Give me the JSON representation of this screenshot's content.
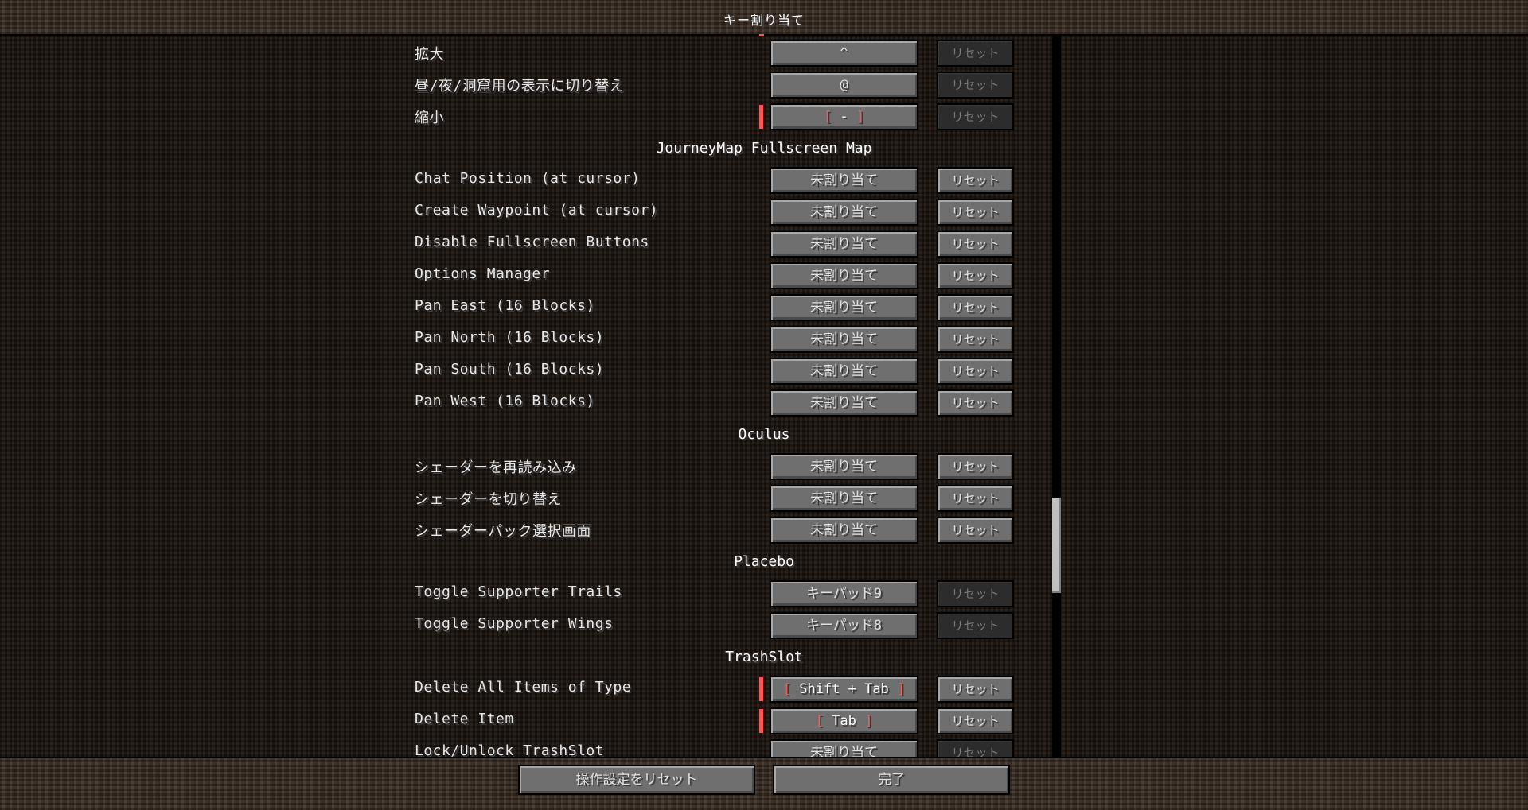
{
  "title": "キー割り当て",
  "rows_top": [
    {
      "label": "拡大",
      "key": "^",
      "reset": "リセット"
    },
    {
      "label": "昼/夜/洞窟用の表示に切り替え",
      "key": "@",
      "reset": "リセット"
    },
    {
      "label": "縮小",
      "key": "-",
      "reset": "リセット"
    }
  ],
  "categories": {
    "journeymap": "JourneyMap Fullscreen Map",
    "oculus": "Oculus",
    "placebo": "Placebo",
    "trashslot": "TrashSlot"
  },
  "journeymap_rows": [
    {
      "label": "Chat Position (at cursor)",
      "key": "未割り当て",
      "reset": "リセット"
    },
    {
      "label": "Create Waypoint (at cursor)",
      "key": "未割り当て",
      "reset": "リセット"
    },
    {
      "label": "Disable Fullscreen Buttons",
      "key": "未割り当て",
      "reset": "リセット"
    },
    {
      "label": "Options Manager",
      "key": "未割り当て",
      "reset": "リセット"
    },
    {
      "label": "Pan East (16 Blocks)",
      "key": "未割り当て",
      "reset": "リセット"
    },
    {
      "label": "Pan North (16 Blocks)",
      "key": "未割り当て",
      "reset": "リセット"
    },
    {
      "label": "Pan South (16 Blocks)",
      "key": "未割り当て",
      "reset": "リセット"
    },
    {
      "label": "Pan West (16 Blocks)",
      "key": "未割り当て",
      "reset": "リセット"
    }
  ],
  "oculus_rows": [
    {
      "label": "シェーダーを再読み込み",
      "key": "未割り当て",
      "reset": "リセット"
    },
    {
      "label": "シェーダーを切り替え",
      "key": "未割り当て",
      "reset": "リセット"
    },
    {
      "label": "シェーダーパック選択画面",
      "key": "未割り当て",
      "reset": "リセット"
    }
  ],
  "placebo_rows": [
    {
      "label": "Toggle Supporter Trails",
      "key": "キーパッド9",
      "reset": "リセット"
    },
    {
      "label": "Toggle Supporter Wings",
      "key": "キーパッド8",
      "reset": "リセット"
    }
  ],
  "trashslot_rows": [
    {
      "label": "Delete All Items of Type",
      "key": "Shift + Tab",
      "reset": "リセット"
    },
    {
      "label": "Delete Item",
      "key": "Tab",
      "reset": "リセット"
    },
    {
      "label": "Lock/Unlock TrashSlot",
      "key": "未割り当て",
      "reset": "リセット"
    }
  ],
  "bracket_open": "[",
  "bracket_close": "]",
  "footer": {
    "reset_all": "操作設定をリセット",
    "done": "完了"
  },
  "colors": {
    "conflict": "#ff5555",
    "button": "#6f6f6f",
    "disabled_button": "#2c2c2c"
  }
}
